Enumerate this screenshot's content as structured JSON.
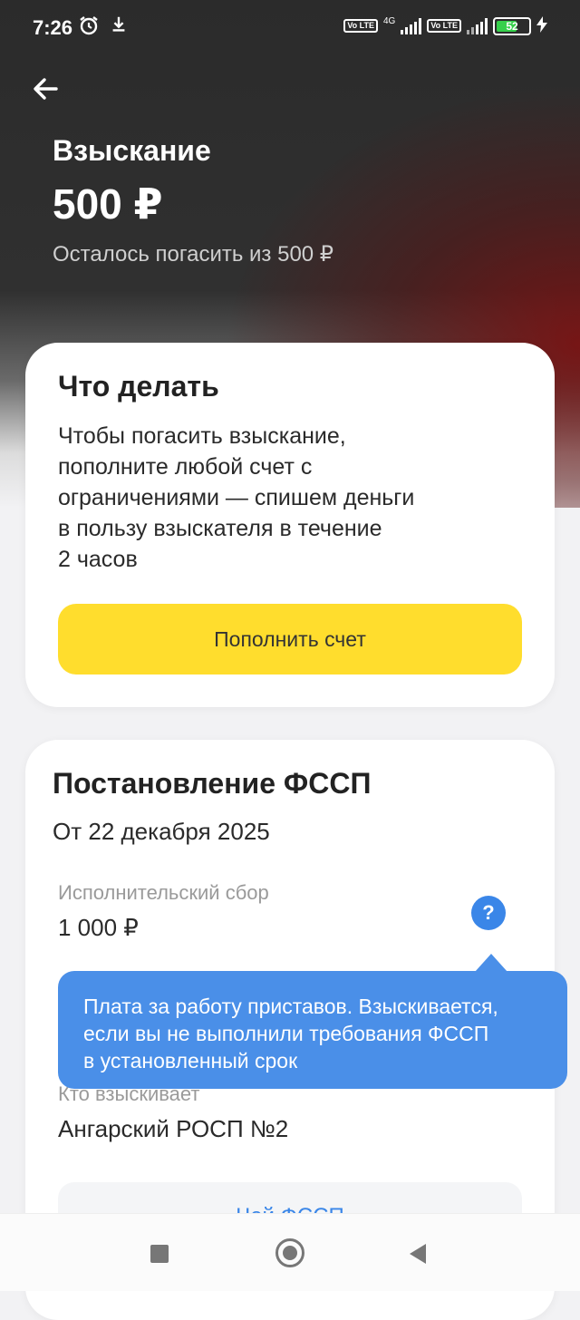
{
  "status_bar": {
    "time": "7:26",
    "network_label": "4G",
    "lte_label_1": "Vo LTE",
    "lte_label_2": "Vo LTE",
    "battery": "52"
  },
  "header": {
    "title": "Взыскание",
    "amount": "500 ₽",
    "remaining": "Осталось погасить из  500 ₽"
  },
  "what_to_do": {
    "title": "Что делать",
    "description": "Чтобы погасить взыскание,\nпополните любой счет с\nограничениями — спишем деньги\nв пользу взыскателя в течение\n2 часов",
    "button_label": "Пополнить счет"
  },
  "resolution": {
    "title": "Постановление ФССП",
    "date": "От 22 декабря 2025",
    "fee_label": "Исполнительский сбор",
    "fee_value": "1 000 ₽",
    "help_icon": "?",
    "tooltip": "Плата за работу приставов. Взыскивается,\nесли вы не выполнили требования ФССП\nв установленный срок",
    "collector_label": "Кто взыскивает",
    "collector_value": "Ангарский РОСП №2",
    "link_label": "Чей ФССП"
  },
  "icons": {
    "back": "arrow-left-icon",
    "alarm": "alarm-icon",
    "download": "download-icon",
    "help": "question-icon",
    "charging": "bolt-icon"
  },
  "colors": {
    "accent_yellow": "#ffdd2d",
    "tooltip_blue": "#4a8fe8",
    "hero_dark": "#2b2b2b",
    "hero_red": "#781212"
  }
}
